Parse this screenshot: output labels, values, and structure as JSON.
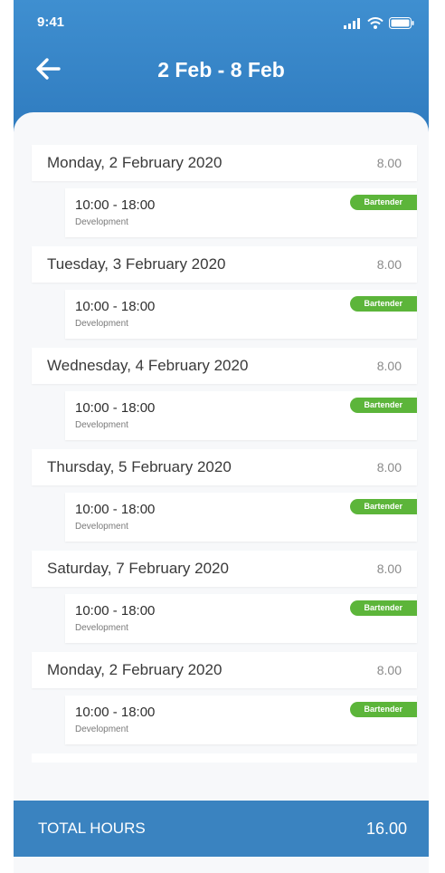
{
  "status_bar": {
    "time": "9:41"
  },
  "header": {
    "title": "2 Feb - 8 Feb"
  },
  "days": [
    {
      "date": "Monday, 2 February 2020",
      "hours": "8.00",
      "shift": {
        "time": "10:00 - 18:00",
        "department": "Development",
        "role": "Bartender"
      }
    },
    {
      "date": "Tuesday, 3 February 2020",
      "hours": "8.00",
      "shift": {
        "time": "10:00 - 18:00",
        "department": "Development",
        "role": "Bartender"
      }
    },
    {
      "date": "Wednesday, 4 February 2020",
      "hours": "8.00",
      "shift": {
        "time": "10:00 - 18:00",
        "department": "Development",
        "role": "Bartender"
      }
    },
    {
      "date": "Thursday, 5 February 2020",
      "hours": "8.00",
      "shift": {
        "time": "10:00 - 18:00",
        "department": "Development",
        "role": "Bartender"
      }
    },
    {
      "date": "Saturday, 7 February 2020",
      "hours": "8.00",
      "shift": {
        "time": "10:00 - 18:00",
        "department": "Development",
        "role": "Bartender"
      }
    },
    {
      "date": "Monday, 2 February 2020",
      "hours": "8.00",
      "shift": {
        "time": "10:00 - 18:00",
        "department": "Development",
        "role": "Bartender"
      }
    }
  ],
  "footer": {
    "label": "TOTAL HOURS",
    "value": "16.00"
  },
  "colors": {
    "header": "#3a83c0",
    "badge": "#5cb53a",
    "background": "#f7f8fa"
  },
  "icons": {
    "back": "arrow-left-icon",
    "signal": "signal-icon",
    "wifi": "wifi-icon",
    "battery": "battery-icon"
  }
}
